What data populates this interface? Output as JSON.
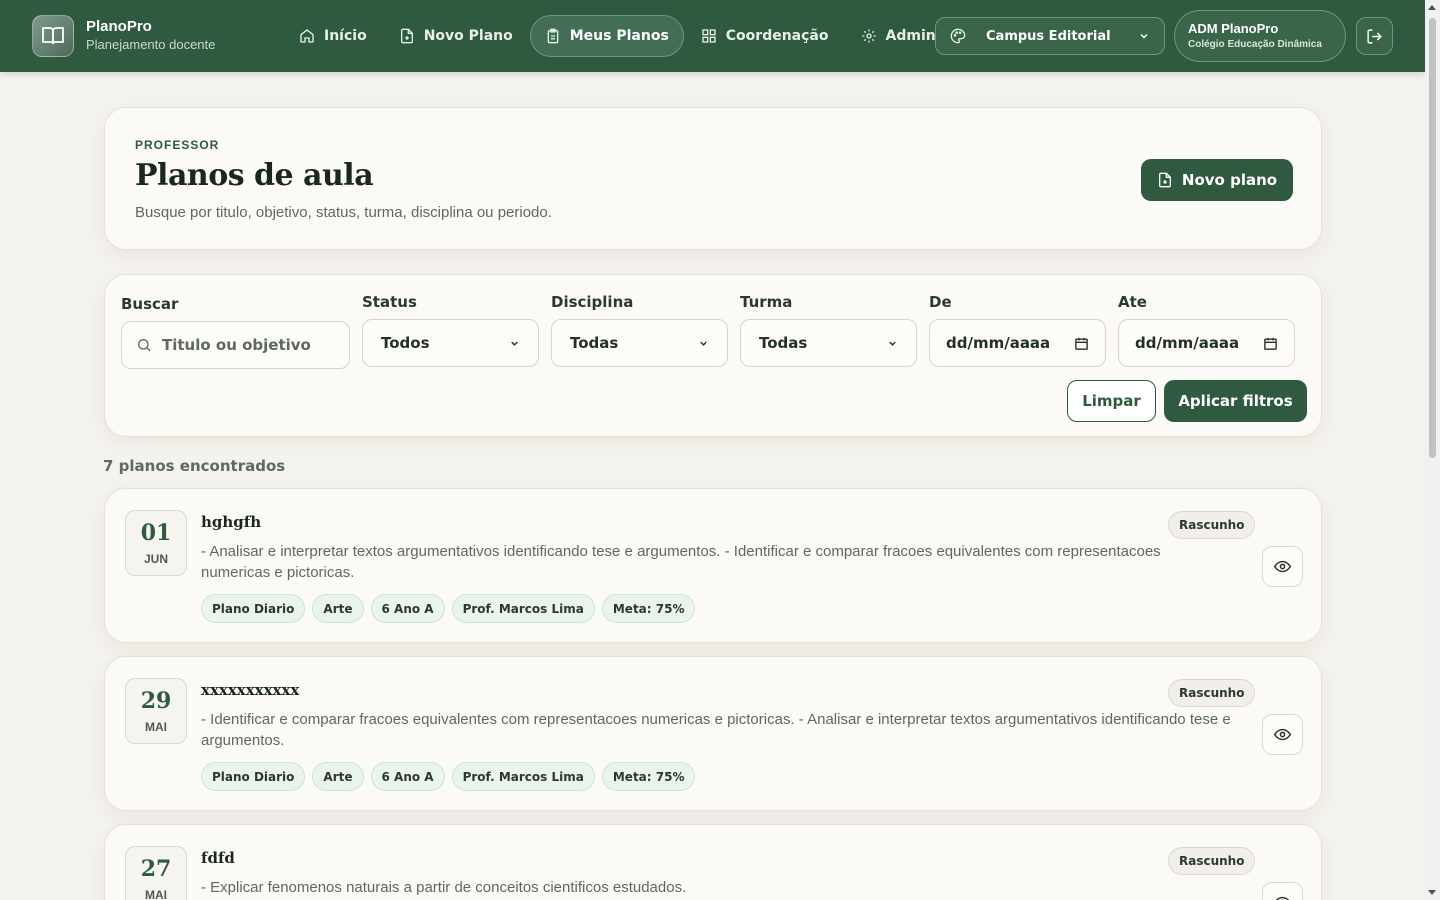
{
  "app": {
    "name": "PlanoPro",
    "subtitle": "Planejamento docente"
  },
  "nav": [
    {
      "label": "Início",
      "icon": "home-icon"
    },
    {
      "label": "Novo Plano",
      "icon": "file-plus-icon"
    },
    {
      "label": "Meus Planos",
      "icon": "clipboard-icon",
      "active": true
    },
    {
      "label": "Coordenação",
      "icon": "grid-icon"
    },
    {
      "label": "Admin",
      "icon": "gear-icon"
    }
  ],
  "campus": {
    "label": "Campus Editorial",
    "icon": "palette-icon"
  },
  "user": {
    "name": "ADM PlanoPro",
    "school": "Colégio Educação Dinâmica"
  },
  "header": {
    "eyebrow": "PROFESSOR",
    "title": "Planos de aula",
    "subtitle": "Busque por titulo, objetivo, status, turma, disciplina ou periodo.",
    "new_plan_label": "Novo plano"
  },
  "filters": {
    "search_label": "Buscar",
    "search_placeholder": "Titulo ou objetivo",
    "status_label": "Status",
    "status_value": "Todos",
    "discipline_label": "Disciplina",
    "discipline_value": "Todas",
    "class_label": "Turma",
    "class_value": "Todas",
    "from_label": "De",
    "from_value": "dd/mm/aaaa",
    "to_label": "Ate",
    "to_value": "dd/mm/aaaa",
    "clear_label": "Limpar",
    "apply_label": "Aplicar filtros"
  },
  "results_count": "7 planos encontrados",
  "plans": [
    {
      "day": "01",
      "month": "JUN",
      "title": "hghgfh",
      "status": "Rascunho",
      "description": "- Analisar e interpretar textos argumentativos identificando tese e argumentos. - Identificar e comparar fracoes equivalentes com representacoes numericas e pictoricas.",
      "tags": [
        "Plano Diario",
        "Arte",
        "6 Ano A",
        "Prof. Marcos Lima",
        "Meta: 75%"
      ]
    },
    {
      "day": "29",
      "month": "MAI",
      "title": "xxxxxxxxxxx",
      "status": "Rascunho",
      "description": "- Identificar e comparar fracoes equivalentes com representacoes numericas e pictoricas. - Analisar e interpretar textos argumentativos identificando tese e argumentos.",
      "tags": [
        "Plano Diario",
        "Arte",
        "6 Ano A",
        "Prof. Marcos Lima",
        "Meta: 75%"
      ]
    },
    {
      "day": "27",
      "month": "MAI",
      "title": "fdfd",
      "status": "Rascunho",
      "description": "- Explicar fenomenos naturais a partir de conceitos cientificos estudados.",
      "tags": []
    }
  ],
  "colors": {
    "primary": "#2f5a40",
    "background": "#f4f2ec",
    "tag_bg": "#e8f4ec"
  }
}
